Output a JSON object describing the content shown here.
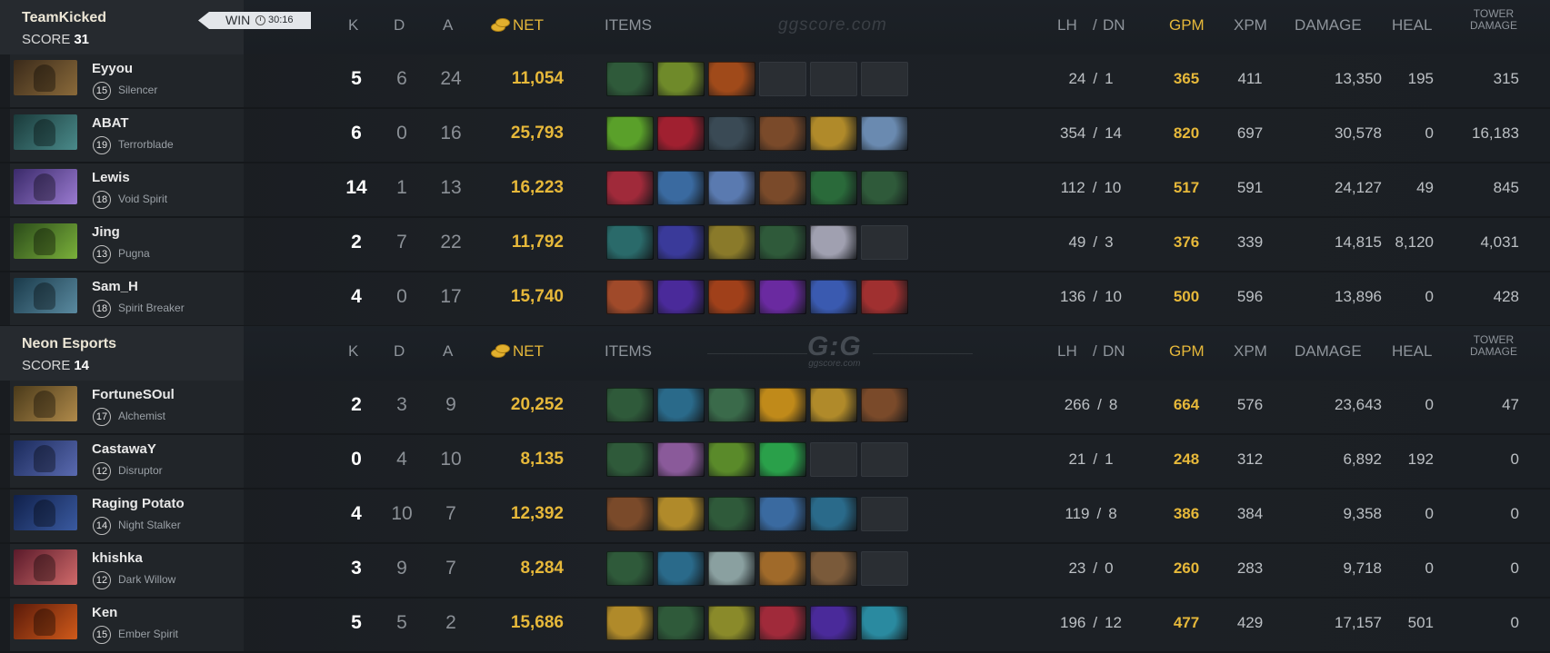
{
  "columns": {
    "k": "K",
    "d": "D",
    "a": "A",
    "net": "NET",
    "items": "ITEMS",
    "lh": "LH",
    "slash": "/",
    "dn": "DN",
    "gpm": "GPM",
    "xpm": "XPM",
    "damage": "DAMAGE",
    "heal": "HEAL",
    "tower_line1": "TOWER",
    "tower_line2": "DAMAGE"
  },
  "watermark": {
    "site": "ggscore.com",
    "logo": "G:G",
    "logo_sub": "ggscore.com"
  },
  "colors": {
    "gold": "#e6b83a",
    "background": "#1b1f24",
    "player_panel": "#212529"
  },
  "teams": [
    {
      "name": "TeamKicked",
      "score_label": "SCORE",
      "score": "31",
      "result": "WIN",
      "clock_icon": "clock-icon",
      "duration": "30:16",
      "players": [
        {
          "name": "Eyyou",
          "level": "15",
          "hero": "Silencer",
          "k": "5",
          "d": "6",
          "a": "24",
          "net": "11,054",
          "lh": "24",
          "dn": "1",
          "gpm": "365",
          "xpm": "411",
          "damage": "13,350",
          "heal": "195",
          "tower": "315",
          "portrait": [
            "#3a2a1a",
            "#8a6a3a"
          ],
          "items": [
            "#2f5a3a",
            "#6f8a2a",
            "#a04a1a",
            "empty",
            "empty",
            "empty"
          ]
        },
        {
          "name": "ABAT",
          "level": "19",
          "hero": "Terrorblade",
          "k": "6",
          "d": "0",
          "a": "16",
          "net": "25,793",
          "lh": "354",
          "dn": "14",
          "gpm": "820",
          "xpm": "697",
          "damage": "30,578",
          "heal": "0",
          "tower": "16,183",
          "portrait": [
            "#1a3a3a",
            "#4a8a8a"
          ],
          "items": [
            "#5aa02a",
            "#a02030",
            "#3a4a55",
            "#7a4a2a",
            "#b08a2a",
            "#6a8ab0"
          ]
        },
        {
          "name": "Lewis",
          "level": "18",
          "hero": "Void Spirit",
          "k": "14",
          "d": "1",
          "a": "13",
          "net": "16,223",
          "lh": "112",
          "dn": "10",
          "gpm": "517",
          "xpm": "591",
          "damage": "24,127",
          "heal": "49",
          "tower": "845",
          "portrait": [
            "#3a2a6a",
            "#9a7ad0"
          ],
          "items": [
            "#a02a3a",
            "#3a6aa0",
            "#5a7ab0",
            "#7a4a2a",
            "#2a6a3a",
            "#2f5a3a"
          ]
        },
        {
          "name": "Jing",
          "level": "13",
          "hero": "Pugna",
          "k": "2",
          "d": "7",
          "a": "22",
          "net": "11,792",
          "lh": "49",
          "dn": "3",
          "gpm": "376",
          "xpm": "339",
          "damage": "14,815",
          "heal": "8,120",
          "tower": "4,031",
          "portrait": [
            "#2a4a1a",
            "#7ab03a"
          ],
          "items": [
            "#2a6a6a",
            "#3a3a9a",
            "#8a7a2a",
            "#2f5a3a",
            "#a0a0b0",
            "empty"
          ]
        },
        {
          "name": "Sam_H",
          "level": "18",
          "hero": "Spirit Breaker",
          "k": "4",
          "d": "0",
          "a": "17",
          "net": "15,740",
          "lh": "136",
          "dn": "10",
          "gpm": "500",
          "xpm": "596",
          "damage": "13,896",
          "heal": "0",
          "tower": "428",
          "portrait": [
            "#1a3a4a",
            "#5a8aa0"
          ],
          "items": [
            "#a04a2a",
            "#4a2a9a",
            "#a0401a",
            "#6a2aa0",
            "#3a5ab0",
            "#a03030"
          ]
        }
      ]
    },
    {
      "name": "Neon Esports",
      "score_label": "SCORE",
      "score": "14",
      "players": [
        {
          "name": "FortuneSOul",
          "level": "17",
          "hero": "Alchemist",
          "k": "2",
          "d": "3",
          "a": "9",
          "net": "20,252",
          "lh": "266",
          "dn": "8",
          "gpm": "664",
          "xpm": "576",
          "damage": "23,643",
          "heal": "0",
          "tower": "47",
          "portrait": [
            "#4a3a1a",
            "#b08a4a"
          ],
          "items": [
            "#2f5a3a",
            "#2a6a8a",
            "#3a6a4a",
            "#c08a1a",
            "#b08a2a",
            "#7a4a2a"
          ]
        },
        {
          "name": "CastawaY",
          "level": "12",
          "hero": "Disruptor",
          "k": "0",
          "d": "4",
          "a": "10",
          "net": "8,135",
          "lh": "21",
          "dn": "1",
          "gpm": "248",
          "xpm": "312",
          "damage": "6,892",
          "heal": "192",
          "tower": "0",
          "portrait": [
            "#1a2a5a",
            "#5a6ab0"
          ],
          "items": [
            "#2f5a3a",
            "#8a5a9a",
            "#5a8a2a",
            "#2aa04a",
            "empty",
            "empty"
          ]
        },
        {
          "name": "Raging Potato",
          "level": "14",
          "hero": "Night Stalker",
          "k": "4",
          "d": "10",
          "a": "7",
          "net": "12,392",
          "lh": "119",
          "dn": "8",
          "gpm": "386",
          "xpm": "384",
          "damage": "9,358",
          "heal": "0",
          "tower": "0",
          "portrait": [
            "#10204a",
            "#3a5aa0"
          ],
          "items": [
            "#7a4a2a",
            "#b08a2a",
            "#2f5a3a",
            "#3a6aa0",
            "#2a6a8a",
            "empty"
          ]
        },
        {
          "name": "khishka",
          "level": "12",
          "hero": "Dark Willow",
          "k": "3",
          "d": "9",
          "a": "7",
          "net": "8,284",
          "lh": "23",
          "dn": "0",
          "gpm": "260",
          "xpm": "283",
          "damage": "9,718",
          "heal": "0",
          "tower": "0",
          "portrait": [
            "#5a1a2a",
            "#d06a6a"
          ],
          "items": [
            "#2f5a3a",
            "#2a6a8a",
            "#8aa0a0",
            "#a06a2a",
            "#7a5a3a",
            "empty"
          ]
        },
        {
          "name": "Ken",
          "level": "15",
          "hero": "Ember Spirit",
          "k": "5",
          "d": "5",
          "a": "2",
          "net": "15,686",
          "lh": "196",
          "dn": "12",
          "gpm": "477",
          "xpm": "429",
          "damage": "17,157",
          "heal": "501",
          "tower": "0",
          "portrait": [
            "#5a1a0a",
            "#d05a1a"
          ],
          "items": [
            "#b08a2a",
            "#2f5a3a",
            "#8a8a2a",
            "#a02a3a",
            "#4a2a9a",
            "#2a8aa0"
          ]
        }
      ]
    }
  ]
}
